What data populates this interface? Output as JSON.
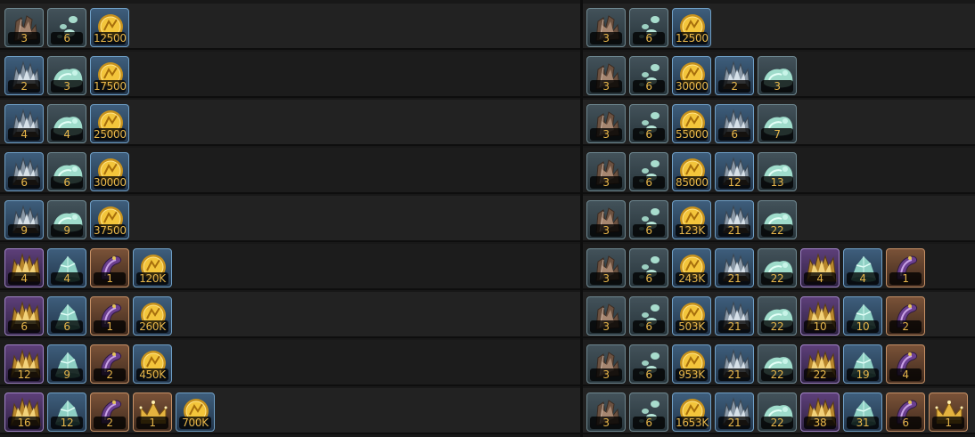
{
  "icon_types": {
    "ore": {
      "icon": "grey-ore-icon",
      "rarity": "grey",
      "color": "#8a6f5c"
    },
    "gem": {
      "icon": "grey-gem-icon",
      "rarity": "grey",
      "color": "#9fd4c5"
    },
    "coin": {
      "icon": "gold-coin-icon",
      "rarity": "blue",
      "color": "#f0c33c"
    },
    "silver_ore": {
      "icon": "silver-ore-icon",
      "rarity": "blue",
      "color": "#c9d4dc"
    },
    "aqua_gem": {
      "icon": "aqua-gem-icon",
      "rarity": "grey",
      "color": "#a7e6d8"
    },
    "gold_ore": {
      "icon": "gold-ore-icon",
      "rarity": "purple",
      "color": "#e9c46a"
    },
    "crystal_gem": {
      "icon": "crystal-gem-icon",
      "rarity": "blue",
      "color": "#bfeee6"
    },
    "horn": {
      "icon": "curved-horn-icon",
      "rarity": "orange",
      "color": "#8b5fb0"
    },
    "crown": {
      "icon": "crown-icon",
      "rarity": "orange",
      "color": "#f2c24e"
    }
  },
  "left_rows": [
    [
      {
        "type": "ore",
        "qty": "3"
      },
      {
        "type": "gem",
        "qty": "6"
      },
      {
        "type": "coin",
        "qty": "12500"
      }
    ],
    [
      {
        "type": "silver_ore",
        "qty": "2"
      },
      {
        "type": "aqua_gem",
        "qty": "3"
      },
      {
        "type": "coin",
        "qty": "17500"
      }
    ],
    [
      {
        "type": "silver_ore",
        "qty": "4"
      },
      {
        "type": "aqua_gem",
        "qty": "4"
      },
      {
        "type": "coin",
        "qty": "25000"
      }
    ],
    [
      {
        "type": "silver_ore",
        "qty": "6"
      },
      {
        "type": "aqua_gem",
        "qty": "6"
      },
      {
        "type": "coin",
        "qty": "30000"
      }
    ],
    [
      {
        "type": "silver_ore",
        "qty": "9"
      },
      {
        "type": "aqua_gem",
        "qty": "9"
      },
      {
        "type": "coin",
        "qty": "37500"
      }
    ],
    [
      {
        "type": "gold_ore",
        "qty": "4"
      },
      {
        "type": "crystal_gem",
        "qty": "4"
      },
      {
        "type": "horn",
        "qty": "1"
      },
      {
        "type": "coin",
        "qty": "120K"
      }
    ],
    [
      {
        "type": "gold_ore",
        "qty": "6"
      },
      {
        "type": "crystal_gem",
        "qty": "6"
      },
      {
        "type": "horn",
        "qty": "1"
      },
      {
        "type": "coin",
        "qty": "260K"
      }
    ],
    [
      {
        "type": "gold_ore",
        "qty": "12"
      },
      {
        "type": "crystal_gem",
        "qty": "9"
      },
      {
        "type": "horn",
        "qty": "2"
      },
      {
        "type": "coin",
        "qty": "450K"
      }
    ],
    [
      {
        "type": "gold_ore",
        "qty": "16"
      },
      {
        "type": "crystal_gem",
        "qty": "12"
      },
      {
        "type": "horn",
        "qty": "2"
      },
      {
        "type": "crown",
        "qty": "1"
      },
      {
        "type": "coin",
        "qty": "700K"
      }
    ]
  ],
  "right_rows": [
    [
      {
        "type": "ore",
        "qty": "3"
      },
      {
        "type": "gem",
        "qty": "6"
      },
      {
        "type": "coin",
        "qty": "12500"
      }
    ],
    [
      {
        "type": "ore",
        "qty": "3"
      },
      {
        "type": "gem",
        "qty": "6"
      },
      {
        "type": "coin",
        "qty": "30000"
      },
      {
        "type": "silver_ore",
        "qty": "2"
      },
      {
        "type": "aqua_gem",
        "qty": "3"
      }
    ],
    [
      {
        "type": "ore",
        "qty": "3"
      },
      {
        "type": "gem",
        "qty": "6"
      },
      {
        "type": "coin",
        "qty": "55000"
      },
      {
        "type": "silver_ore",
        "qty": "6"
      },
      {
        "type": "aqua_gem",
        "qty": "7"
      }
    ],
    [
      {
        "type": "ore",
        "qty": "3"
      },
      {
        "type": "gem",
        "qty": "6"
      },
      {
        "type": "coin",
        "qty": "85000"
      },
      {
        "type": "silver_ore",
        "qty": "12"
      },
      {
        "type": "aqua_gem",
        "qty": "13"
      }
    ],
    [
      {
        "type": "ore",
        "qty": "3"
      },
      {
        "type": "gem",
        "qty": "6"
      },
      {
        "type": "coin",
        "qty": "123K"
      },
      {
        "type": "silver_ore",
        "qty": "21"
      },
      {
        "type": "aqua_gem",
        "qty": "22"
      }
    ],
    [
      {
        "type": "ore",
        "qty": "3"
      },
      {
        "type": "gem",
        "qty": "6"
      },
      {
        "type": "coin",
        "qty": "243K"
      },
      {
        "type": "silver_ore",
        "qty": "21"
      },
      {
        "type": "aqua_gem",
        "qty": "22"
      },
      {
        "type": "gold_ore",
        "qty": "4"
      },
      {
        "type": "crystal_gem",
        "qty": "4"
      },
      {
        "type": "horn",
        "qty": "1"
      }
    ],
    [
      {
        "type": "ore",
        "qty": "3"
      },
      {
        "type": "gem",
        "qty": "6"
      },
      {
        "type": "coin",
        "qty": "503K"
      },
      {
        "type": "silver_ore",
        "qty": "21"
      },
      {
        "type": "aqua_gem",
        "qty": "22"
      },
      {
        "type": "gold_ore",
        "qty": "10"
      },
      {
        "type": "crystal_gem",
        "qty": "10"
      },
      {
        "type": "horn",
        "qty": "2"
      }
    ],
    [
      {
        "type": "ore",
        "qty": "3"
      },
      {
        "type": "gem",
        "qty": "6"
      },
      {
        "type": "coin",
        "qty": "953K"
      },
      {
        "type": "silver_ore",
        "qty": "21"
      },
      {
        "type": "aqua_gem",
        "qty": "22"
      },
      {
        "type": "gold_ore",
        "qty": "22"
      },
      {
        "type": "crystal_gem",
        "qty": "19"
      },
      {
        "type": "horn",
        "qty": "4"
      }
    ],
    [
      {
        "type": "ore",
        "qty": "3"
      },
      {
        "type": "gem",
        "qty": "6"
      },
      {
        "type": "coin",
        "qty": "1653K"
      },
      {
        "type": "silver_ore",
        "qty": "21"
      },
      {
        "type": "aqua_gem",
        "qty": "22"
      },
      {
        "type": "gold_ore",
        "qty": "38"
      },
      {
        "type": "crystal_gem",
        "qty": "31"
      },
      {
        "type": "horn",
        "qty": "6"
      },
      {
        "type": "crown",
        "qty": "1"
      }
    ]
  ]
}
